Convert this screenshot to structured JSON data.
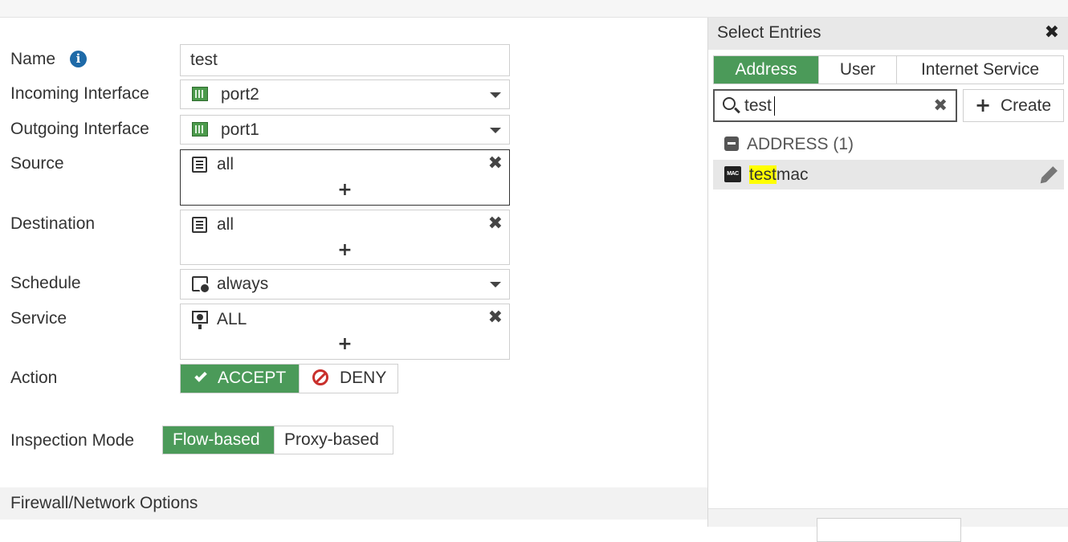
{
  "form": {
    "name_label": "Name",
    "name_value": "test",
    "incoming_label": "Incoming Interface",
    "incoming_value": "port2",
    "outgoing_label": "Outgoing Interface",
    "outgoing_value": "port1",
    "source_label": "Source",
    "source_value": "all",
    "destination_label": "Destination",
    "destination_value": "all",
    "schedule_label": "Schedule",
    "schedule_value": "always",
    "service_label": "Service",
    "service_value": "ALL",
    "action_label": "Action",
    "action_accept": "ACCEPT",
    "action_deny": "DENY",
    "inspection_label": "Inspection Mode",
    "inspection_flow": "Flow-based",
    "inspection_proxy": "Proxy-based",
    "section_title": "Firewall/Network Options",
    "remove_glyph": "✖",
    "add_glyph": "+"
  },
  "panel": {
    "title": "Select Entries",
    "close_glyph": "✖",
    "tabs": [
      "Address",
      "User",
      "Internet Service"
    ],
    "search_value": "test",
    "clear_glyph": "✖",
    "create_glyph": "+",
    "create_label": "Create",
    "group_label": "ADDRESS (1)",
    "entry_icon_text": "MAC",
    "entry_highlight": "test",
    "entry_rest": "mac"
  },
  "colors": {
    "accent_green": "#4b9a59",
    "info_blue": "#1e6aa8",
    "deny_red": "#c9302c",
    "highlight_yellow": "#ffff00"
  },
  "icons": {
    "name_info": "info-icon",
    "interface": "port-icon",
    "address": "address-icon",
    "schedule": "schedule-icon",
    "service": "service-icon",
    "accept": "check-icon",
    "deny": "deny-icon",
    "search": "search-icon",
    "group": "collapse-icon",
    "entry": "mac-icon",
    "edit": "pencil-icon"
  }
}
